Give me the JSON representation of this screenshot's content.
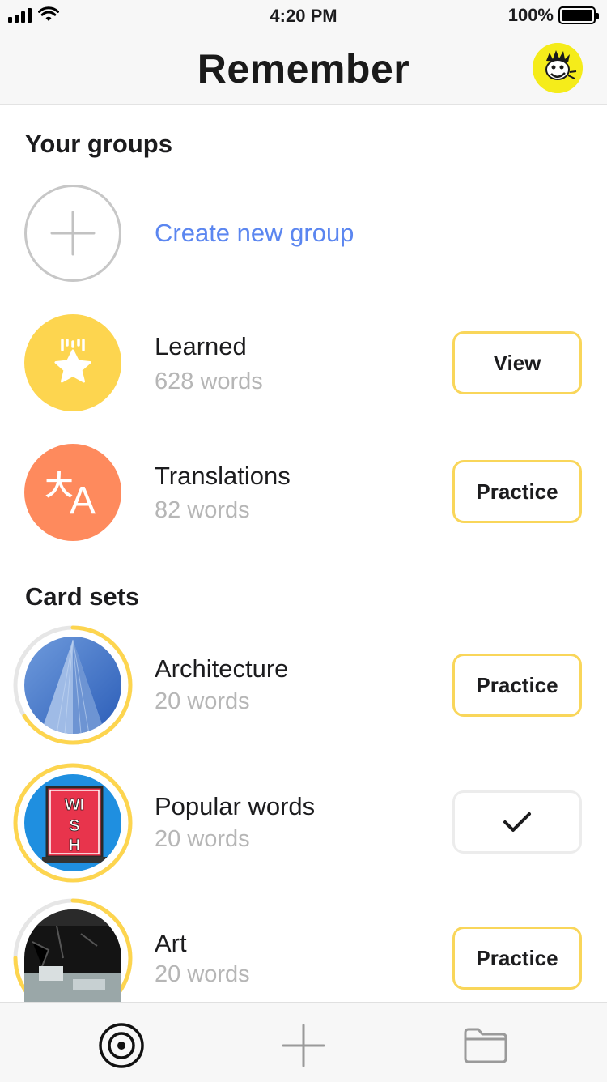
{
  "status_bar": {
    "time": "4:20 PM",
    "battery_percent": "100%",
    "battery_level": 1.0,
    "icons": [
      "signal-icon",
      "wifi-icon",
      "battery-icon"
    ]
  },
  "header": {
    "title": "Remember",
    "avatar_icon": "cartoon-avatar"
  },
  "groups": {
    "section_title": "Your groups",
    "create_label": "Create new group",
    "items": [
      {
        "name": "Learned",
        "count": "628 words",
        "button": "View",
        "icon": "star-icon",
        "color": "#fdd54f"
      },
      {
        "name": "Translations",
        "count": "82 words",
        "button": "Practice",
        "icon": "translate-icon",
        "color": "#fe8a5d"
      }
    ]
  },
  "card_sets": {
    "section_title": "Card sets",
    "items": [
      {
        "name": "Architecture",
        "count": "20 words",
        "button": "Practice",
        "progress": 0.66,
        "image": "skyscraper"
      },
      {
        "name": "Popular words",
        "count": "20 words",
        "button": "",
        "button_icon": "checkmark-icon",
        "progress": 1.0,
        "image": "wish-sign"
      },
      {
        "name": "Art",
        "count": "20 words",
        "button": "Practice",
        "progress": 0.75,
        "image": "abstract-art"
      }
    ]
  },
  "tab_bar": {
    "tabs": [
      {
        "icon": "target-icon",
        "active": true
      },
      {
        "icon": "plus-icon",
        "active": false
      },
      {
        "icon": "folder-icon",
        "active": false
      }
    ]
  },
  "colors": {
    "accent": "#f9d65a",
    "link": "#5b86f0",
    "muted_text": "#b6b6b6"
  }
}
